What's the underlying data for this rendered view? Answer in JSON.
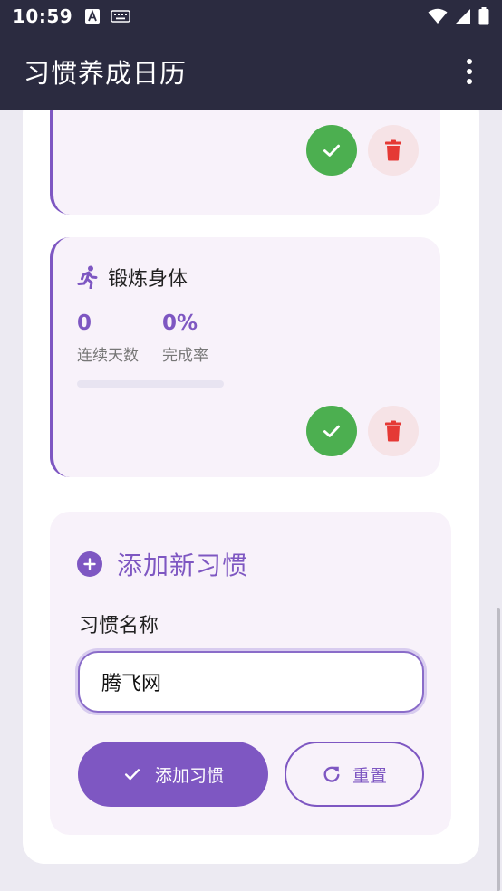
{
  "status_bar": {
    "time": "10:59",
    "icons_left": [
      "text-a-icon",
      "keyboard-icon"
    ],
    "icons_right": [
      "wifi-icon",
      "signal-icon",
      "battery-icon"
    ]
  },
  "app_bar": {
    "title": "习惯养成日历",
    "menu_icon": "more-vert-icon"
  },
  "habits": [
    {
      "title": "",
      "progress": 0
    },
    {
      "title": "锻炼身体",
      "icon": "running-icon",
      "stats": [
        {
          "value": "0",
          "label": "连续天数"
        },
        {
          "value": "0%",
          "label": "完成率"
        }
      ],
      "progress": 0
    }
  ],
  "add_form": {
    "title": "添加新习惯",
    "name_label": "习惯名称",
    "name_value": "腾飞网",
    "add_button": "添加习惯",
    "reset_button": "重置"
  },
  "colors": {
    "primary": "#7e57c2",
    "app_bar": "#2b2b40",
    "success": "#4caf50",
    "danger": "#e53935",
    "card_bg": "#f8f2fa"
  }
}
